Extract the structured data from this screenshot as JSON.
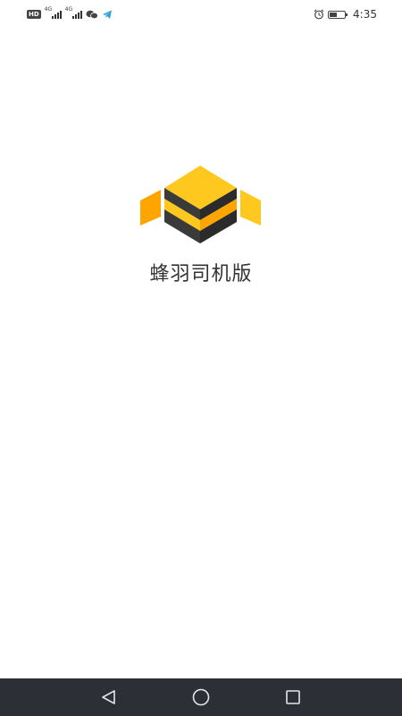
{
  "status_bar": {
    "hd_label": "HD",
    "network_1": "4G",
    "network_2": "4G",
    "time": "4:35",
    "battery_level": 0.5,
    "icons": [
      "hd-icon",
      "signal-icon",
      "signal-icon",
      "wechat-icon",
      "telegram-icon",
      "alarm-icon",
      "battery-icon"
    ]
  },
  "splash": {
    "app_name": "蜂羽司机版",
    "logo_colors": {
      "yellow": "#FFC81E",
      "orange": "#FFA500",
      "dark": "#3a3a3a"
    }
  },
  "nav_bar": {
    "buttons": [
      "back-icon",
      "home-icon",
      "recents-icon"
    ],
    "background": "#2c2f36"
  }
}
